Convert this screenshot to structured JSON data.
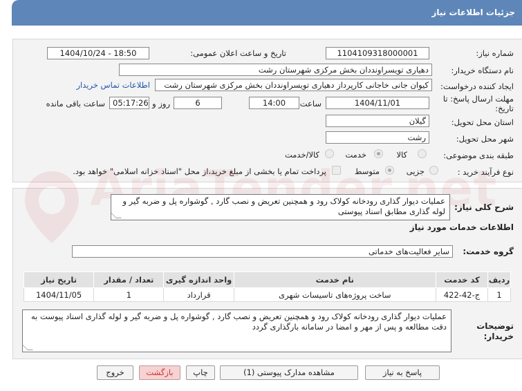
{
  "header": {
    "title": "جزئیات اطلاعات نیاز"
  },
  "labels": {
    "need_number": "شماره نیاز:",
    "announce_datetime": "تاریخ و ساعت اعلان عمومی:",
    "buyer_org": "نام دستگاه خریدار:",
    "requester": "ایجاد کننده درخواست:",
    "deadline_line1": "مهلت ارسال پاسخ: تا",
    "deadline_line2": "تاریخ:",
    "time_label": "ساعت",
    "days_and": "روز و",
    "remaining": "ساعت باقی مانده",
    "province": "استان محل تحویل:",
    "city": "شهر محل تحویل:",
    "category": "طبقه بندی موضوعی:",
    "process_type": "نوع فرآیند خرید :",
    "general_desc": "شرح کلی نیاز:",
    "services_info": "اطلاعات خدمات مورد نیاز",
    "service_group": "گروه خدمت:",
    "buyer_notes_line1": "توضیحات",
    "buyer_notes_line2": "خریدار:"
  },
  "values": {
    "need_number": "1104109318000001",
    "announce_datetime": "1404/10/24 - 18:50",
    "buyer_org": "دهیاری تویسراونددان بخش مرکزی شهرستان رشت",
    "requester": "کیوان جانی خاجانی کارپرداز دهیاری تویسراونددان بخش مرکزی شهرستان رشت",
    "contact_link": "اطلاعات تماس خریدار",
    "deadline_date": "1404/11/01",
    "deadline_time": "14:00",
    "days": "6",
    "remaining_time": "05:17:26",
    "province": "گیلان",
    "city": "رشت",
    "general_desc": "عملیات دیوار گذاری رودخانه کولاک رود  و همچنین  تعریض  و نصب گارد , گوشواره پل و ضربه گیر و لوله گذاری مطابق اسناد پیوستی",
    "service_group": "سایر فعالیت‌های خدماتی",
    "buyer_notes": "عملیات دیوار گذاری رودخانه کولاک رود  و همچنین  تعریض  و نصب گارد , گوشواره پل و ضربه گیر و لوله گذاری اسناد پیوست به دقت مطالعه و پس از مهر و امضا در سامانه بارگذاری گردد"
  },
  "category_options": [
    {
      "label": "کالا",
      "selected": false
    },
    {
      "label": "خدمت",
      "selected": true
    },
    {
      "label": "کالا/خدمت",
      "selected": false
    }
  ],
  "process_options": [
    {
      "label": "جزیی",
      "selected": false
    },
    {
      "label": "متوسط",
      "selected": true
    }
  ],
  "payment_note": "پرداخت تمام یا بخشی از مبلغ خرید،از محل \"اسناد خزانه اسلامی\" خواهد بود.",
  "table": {
    "headers": [
      "ردیف",
      "کد خدمت",
      "نام خدمت",
      "واحد اندازه گیری",
      "تعداد / مقدار",
      "تاریخ نیاز"
    ],
    "rows": [
      [
        "1",
        "ج-42-422",
        "ساخت پروژه‌های تاسیسات شهری",
        "قرارداد",
        "1",
        "1404/11/05"
      ]
    ]
  },
  "buttons": {
    "reply": "پاسخ به نیاز",
    "view_docs": "مشاهده مدارک پیوستی (1)",
    "print": "چاپ",
    "back": "بازگشت",
    "exit": "خروج"
  },
  "watermark": "AriaTender.net"
}
